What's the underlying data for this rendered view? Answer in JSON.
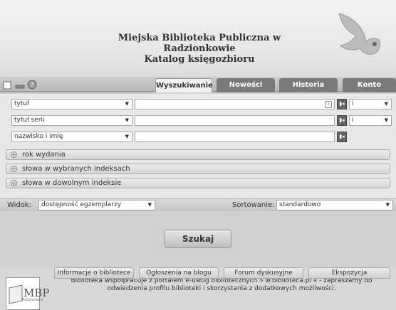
{
  "header": {
    "title_line1": "Miejska Biblioteka Publiczna w Radzionkowie",
    "title_line2": "Katalog księgozbioru"
  },
  "tabs": {
    "search": "Wyszukiwanie",
    "news": "Nowości",
    "history": "Historia",
    "account": "Konto"
  },
  "search": {
    "row1": {
      "field": "tytuł",
      "operator": "i"
    },
    "row2": {
      "field": "tytuł serii",
      "operator": "i"
    },
    "row3": {
      "field": "nazwisko i imię"
    }
  },
  "expanders": {
    "year": "rok wydania",
    "index_words": "słowa w wybranych indeksach",
    "any_index": "słowa w dowolnym indeksie"
  },
  "options": {
    "view_label": "Widok:",
    "view_value": "dostępność egzemplarzy",
    "sort_label": "Sortowanie:",
    "sort_value": "standardowo"
  },
  "submit_label": "Szukaj",
  "footer": {
    "logo_text": "MBP",
    "logo_sub": "Radzionków",
    "text_line1": "Biblioteka współpracuje z portalem e-usług bibliotecznych » w.biblioteca.pl « - zapraszamy do",
    "text_line2": "odwiedzenia profilu biblioteki i skorzystania z dodatkowych możliwości.",
    "links": [
      "Informacje o bibliotece",
      "Ogłoszenia na blogu",
      "Forum dyskusyjne",
      "Ekspozycja"
    ]
  }
}
